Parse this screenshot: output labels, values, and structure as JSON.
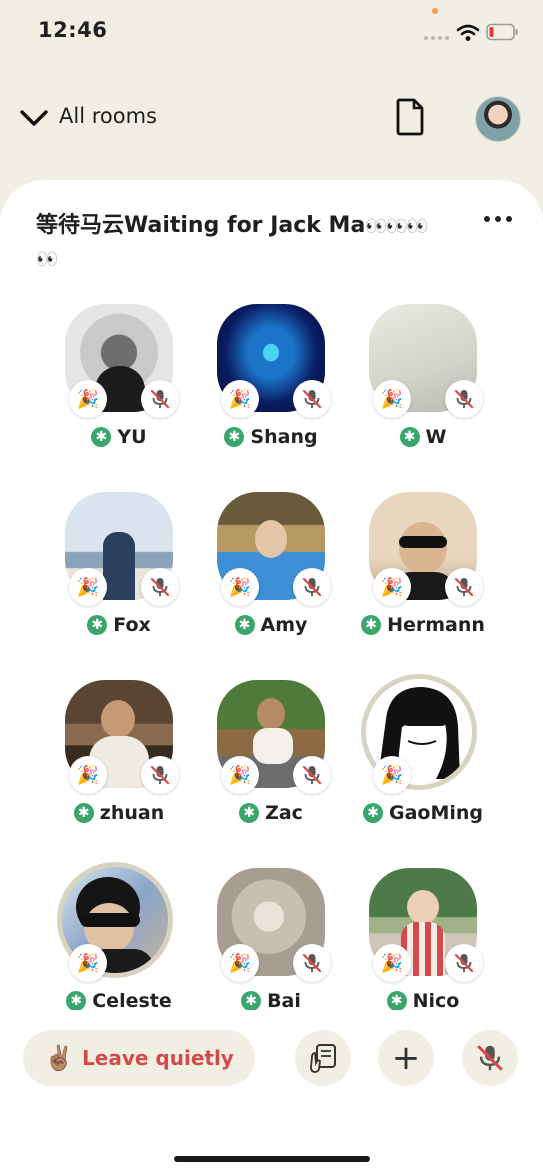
{
  "status_bar": {
    "time": "12:46"
  },
  "header": {
    "rooms_label": "All rooms"
  },
  "room": {
    "title": "等待马云Waiting for Jack Ma",
    "title_emoji_1": "👀👀👀",
    "title_emoji_2": "👀"
  },
  "speakers": [
    {
      "name": "YU",
      "star": "✱",
      "party": "🎉"
    },
    {
      "name": "Shang",
      "star": "✱",
      "party": "🎉"
    },
    {
      "name": "W",
      "star": "✱",
      "party": "🎉"
    },
    {
      "name": "Fox",
      "star": "✱",
      "party": "🎉"
    },
    {
      "name": "Amy",
      "star": "✱",
      "party": "🎉"
    },
    {
      "name": "Hermann",
      "star": "✱",
      "party": "🎉"
    },
    {
      "name": "zhuan",
      "star": "✱",
      "party": "🎉"
    },
    {
      "name": "Zac",
      "star": "✱",
      "party": "🎉"
    },
    {
      "name": "GaoMing",
      "star": "✱",
      "party": "🎉"
    },
    {
      "name": "Celeste",
      "star": "✱",
      "party": "🎉"
    },
    {
      "name": "Bai",
      "star": "✱",
      "party": "🎉"
    },
    {
      "name": "Nico",
      "star": "✱",
      "party": "🎉"
    }
  ],
  "bottom_bar": {
    "leave_emoji": "✌🏽",
    "leave_label": "Leave quietly",
    "plus_label": "+"
  },
  "icons": {
    "back": "chevron-down-icon",
    "doc": "document-icon",
    "more": "more-icon",
    "mute": "mic-muted-icon",
    "raise": "raise-hand-icon"
  },
  "colors": {
    "accent_green": "#3aa66c",
    "leave_red": "#d24a4a",
    "background": "#f1efe4"
  }
}
